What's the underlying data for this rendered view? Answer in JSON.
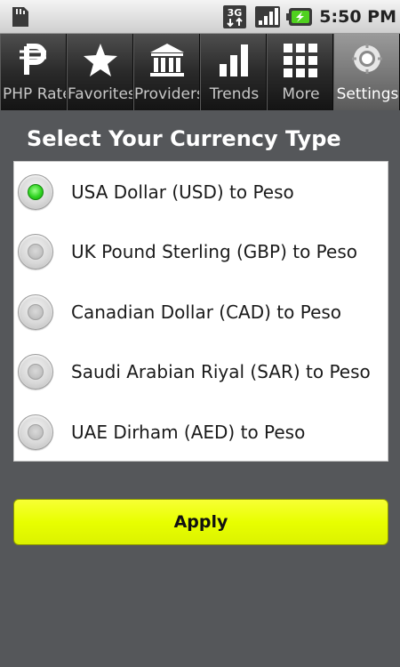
{
  "status_bar": {
    "time": "5:50 PM",
    "network_label": "3G",
    "icons": [
      "sd-card-icon",
      "network-3g-icon",
      "signal-strength-icon",
      "battery-charging-icon"
    ]
  },
  "tabs": [
    {
      "label": "PHP Rates",
      "icon": "peso-icon",
      "selected": false
    },
    {
      "label": "Favorites",
      "icon": "star-icon",
      "selected": false
    },
    {
      "label": "Providers",
      "icon": "bank-icon",
      "selected": false
    },
    {
      "label": "Trends",
      "icon": "bar-chart-icon",
      "selected": false
    },
    {
      "label": "More",
      "icon": "grid-icon",
      "selected": false
    },
    {
      "label": "Settings",
      "icon": "settings-icon",
      "selected": true
    }
  ],
  "settings": {
    "heading": "Select Your Currency Type",
    "options": [
      {
        "label": "USA Dollar (USD) to Peso",
        "checked": true
      },
      {
        "label": "UK Pound Sterling (GBP) to Peso",
        "checked": false
      },
      {
        "label": "Canadian Dollar (CAD) to Peso",
        "checked": false
      },
      {
        "label": "Saudi Arabian Riyal (SAR) to Peso",
        "checked": false
      },
      {
        "label": "UAE Dirham (AED) to Peso",
        "checked": false
      }
    ],
    "apply_label": "Apply"
  },
  "colors": {
    "background": "#55575a",
    "apply_button": "#e8ff00",
    "radio_selected": "#2fd321",
    "tab_bar": "#1b1b1b"
  }
}
